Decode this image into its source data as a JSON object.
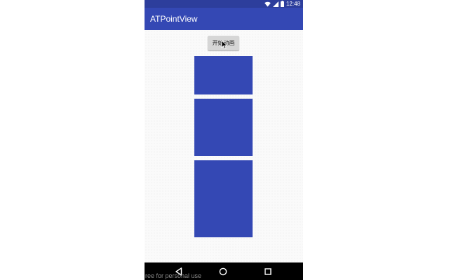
{
  "status_bar": {
    "time": "12:48",
    "icons": [
      "wifi-icon",
      "signal-icon",
      "battery-icon"
    ],
    "color": "#2d3e9c"
  },
  "app_bar": {
    "title": "ATPointView",
    "color": "#3448b4"
  },
  "content": {
    "start_button_label": "开始动画",
    "block_color": "#3448b4",
    "cursor": "mouse-pointer-icon"
  },
  "nav_bar": {
    "buttons": [
      "back-icon",
      "home-icon",
      "recent-apps-icon"
    ]
  },
  "watermark": "ree for personal use"
}
